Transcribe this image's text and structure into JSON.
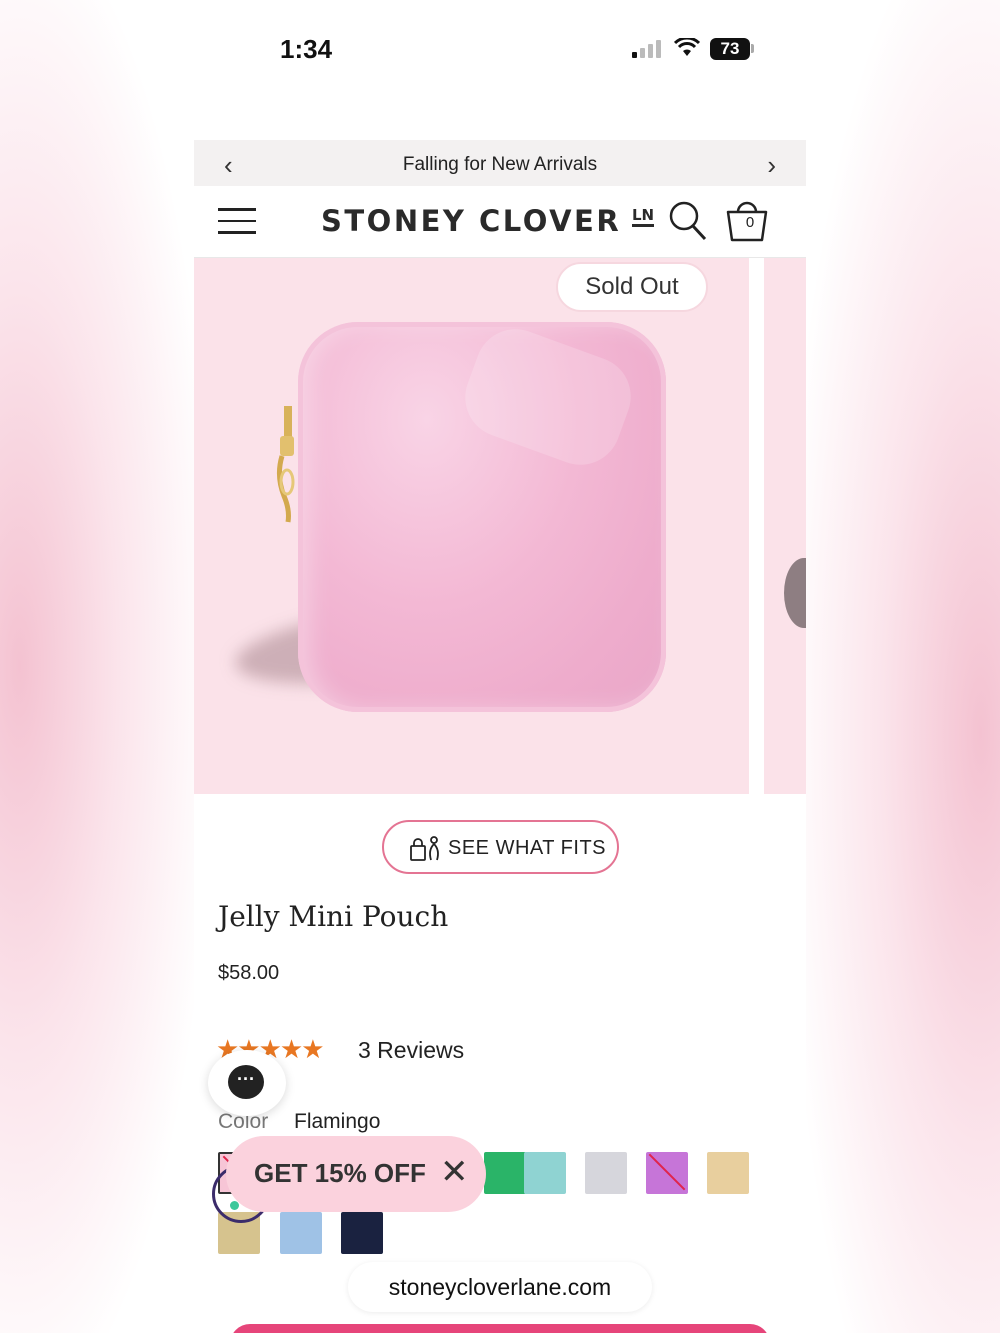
{
  "status": {
    "time": "1:34",
    "battery": "73"
  },
  "announcement": {
    "text": "Falling for New Arrivals"
  },
  "header": {
    "logo": "STONEY CLOVER",
    "logo_mark": "LN",
    "cart_count": "0"
  },
  "product": {
    "badge": "Sold Out",
    "see_what_fits": "SEE WHAT FITS",
    "title": "Jelly Mini Pouch",
    "price": "$58.00",
    "rating_stars": "★★★★★",
    "rating": 5,
    "reviews": "3 Reviews",
    "color_label": "Color",
    "color_value": "Flamingo",
    "swatches": [
      {
        "name": "flamingo",
        "color": "#f7c5d6",
        "sold_out": true
      },
      {
        "name": "green",
        "color": "#2ab468",
        "sold_out": false
      },
      {
        "name": "aqua",
        "color": "#8fd3d2",
        "sold_out": false
      },
      {
        "name": "silver",
        "color": "#d6d6dc",
        "sold_out": false
      },
      {
        "name": "purple",
        "color": "#c675d8",
        "sold_out": true
      },
      {
        "name": "gold-light",
        "color": "#e8cf9e",
        "sold_out": false
      },
      {
        "name": "gold",
        "color": "#d6c38e",
        "sold_out": false
      },
      {
        "name": "sky-blue",
        "color": "#9fc2e6",
        "sold_out": false
      },
      {
        "name": "navy",
        "color": "#1a2240",
        "sold_out": false
      }
    ]
  },
  "promo": {
    "text": "GET 15% OFF"
  },
  "browser": {
    "url": "stoneycloverlane.com"
  },
  "colors": {
    "accent": "#e47493",
    "star": "#e87722",
    "cta": "#e6457a"
  }
}
